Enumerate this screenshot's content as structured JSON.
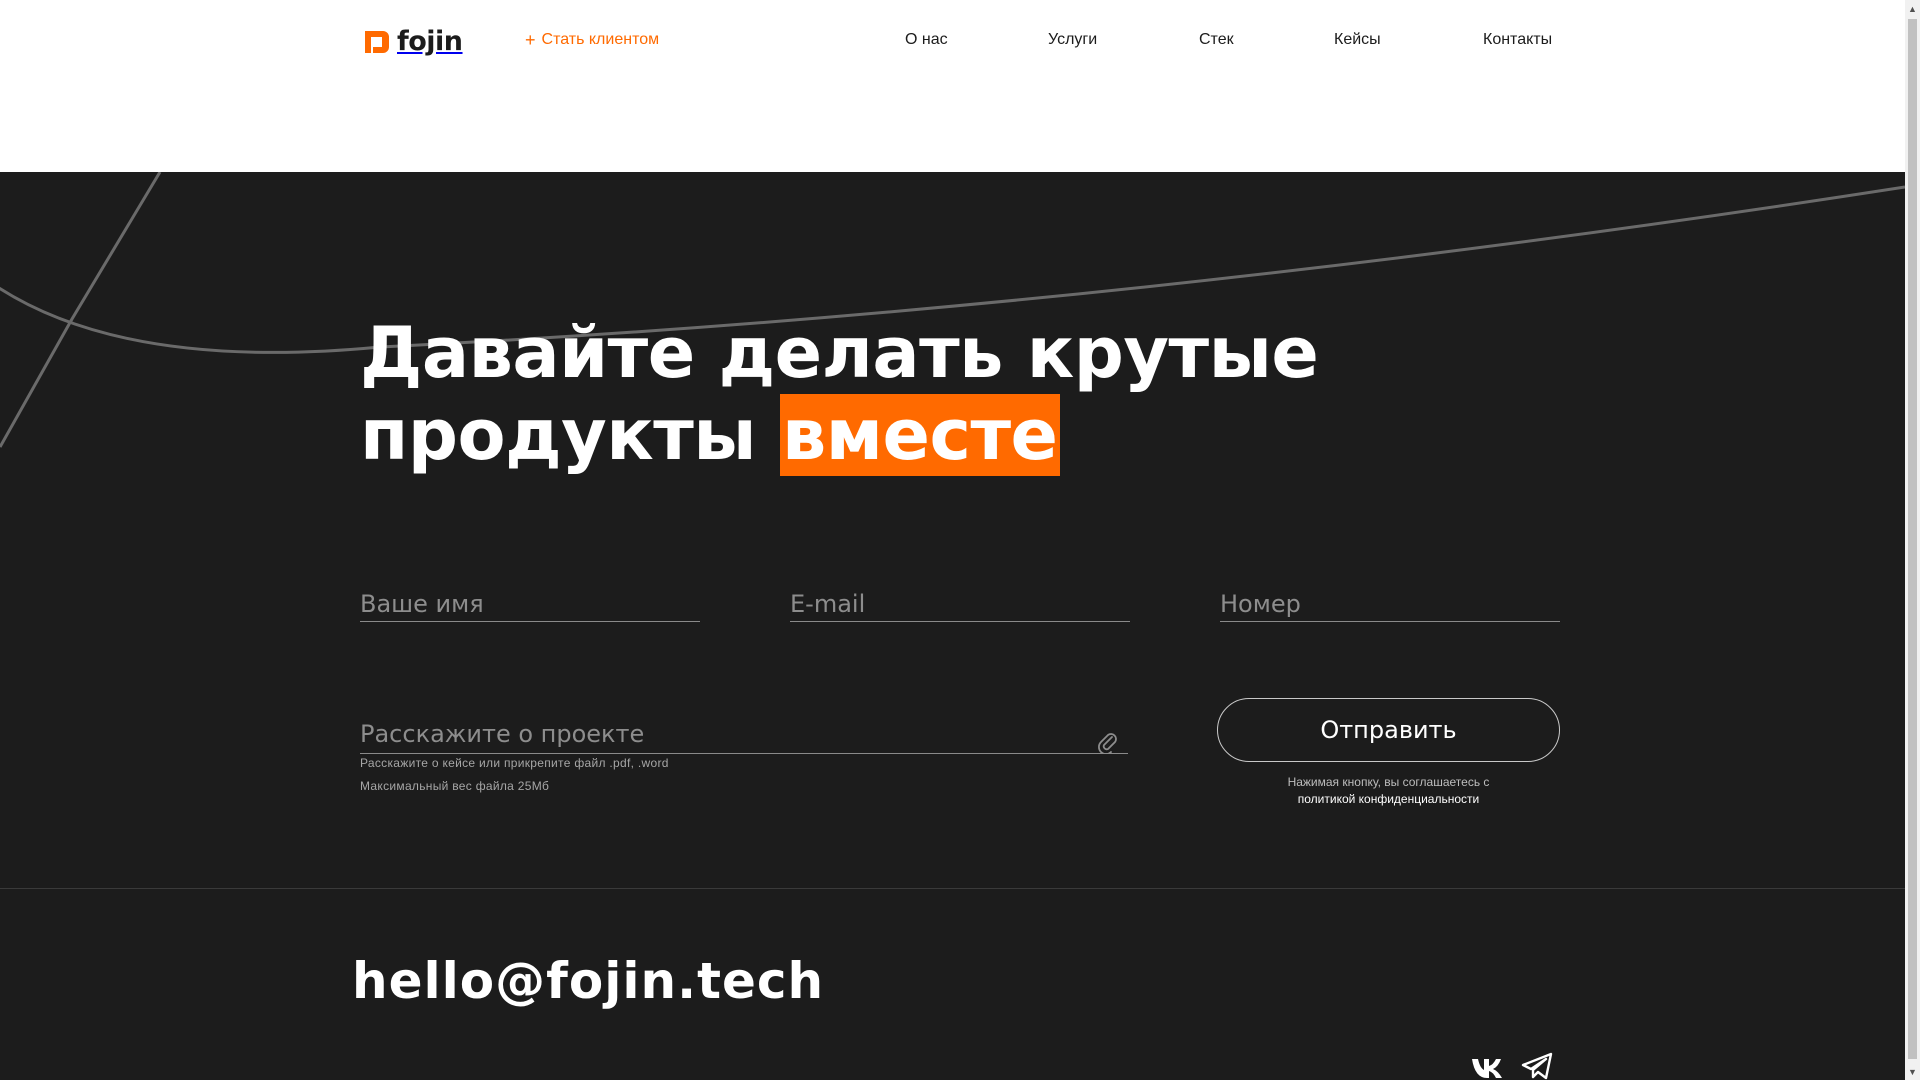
{
  "header": {
    "logo_text": "fojin",
    "cta_label": "Стать клиентом",
    "nav": [
      "О нас",
      "Услуги",
      "Стек",
      "Кейсы",
      "Контакты"
    ]
  },
  "hero": {
    "line1": "Давайте делать крутые",
    "line2": "продукты",
    "highlight": "вместе"
  },
  "form": {
    "name_placeholder": "Ваше имя",
    "email_placeholder": "E-mail",
    "phone_placeholder": "Номер",
    "project_placeholder": "Расскажите о проекте",
    "hint1": "Расскажите о кейсе или прикрепите файл .pdf, .word",
    "hint2": "Максимальный вес файла 25Мб",
    "submit_label": "Отправить",
    "consent_text": "Нажимая кнопку, вы соглашаетесь с",
    "consent_link": "политикой конфиденциальности"
  },
  "contact": {
    "email": "hello@fojin.tech"
  },
  "icons": {
    "logo": "fojin-logo-icon",
    "attach": "paperclip-icon",
    "vk": "vk-icon",
    "telegram": "telegram-icon"
  },
  "colors": {
    "accent": "#ff6a00",
    "dark_bg": "#1c1c1c",
    "header_bg": "#ffffff"
  }
}
